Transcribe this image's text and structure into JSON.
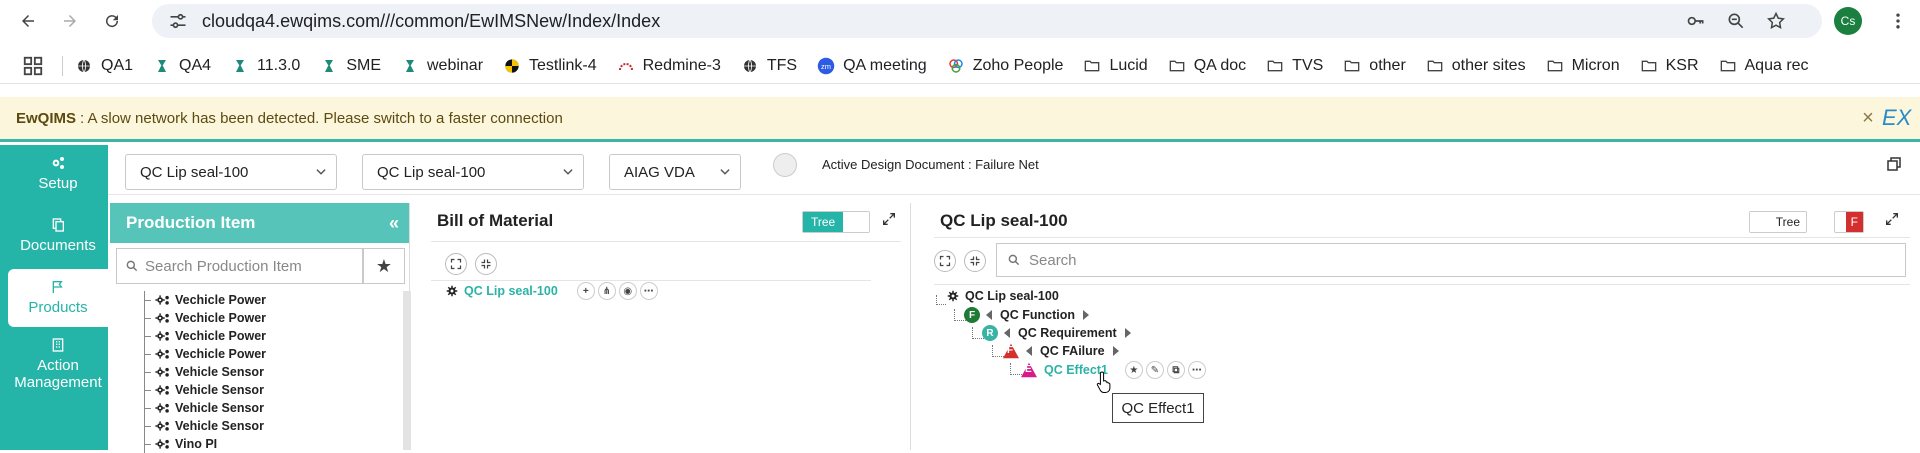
{
  "browser": {
    "url": "cloudqa4.ewqims.com///common/EwIMSNew/Index/Index",
    "avatar": "Cs"
  },
  "bookmarks": [
    {
      "label": "QA1",
      "icon": "globe-icon"
    },
    {
      "label": "QA4",
      "icon": "logo-icon"
    },
    {
      "label": "11.3.0",
      "icon": "logo-icon"
    },
    {
      "label": "SME",
      "icon": "logo-icon"
    },
    {
      "label": "webinar",
      "icon": "logo-icon"
    },
    {
      "label": "Testlink-4",
      "icon": "testlink-icon"
    },
    {
      "label": "Redmine-3",
      "icon": "redmine-icon"
    },
    {
      "label": "TFS",
      "icon": "globe-icon"
    },
    {
      "label": "QA meeting",
      "icon": "zoom-icon"
    },
    {
      "label": "Zoho People",
      "icon": "zoho-icon"
    },
    {
      "label": "Lucid",
      "icon": "folder-icon"
    },
    {
      "label": "QA doc",
      "icon": "folder-icon"
    },
    {
      "label": "TVS",
      "icon": "folder-icon"
    },
    {
      "label": "other",
      "icon": "folder-icon"
    },
    {
      "label": "other sites",
      "icon": "folder-icon"
    },
    {
      "label": "Micron",
      "icon": "folder-icon"
    },
    {
      "label": "KSR",
      "icon": "folder-icon"
    },
    {
      "label": "Aqua rec",
      "icon": "folder-icon"
    }
  ],
  "warning": {
    "brand": "EwQIMS",
    "message": ": A slow network has been detected. Please switch to a faster connection",
    "close": "×",
    "ex": "EX"
  },
  "nav": {
    "setup": "Setup",
    "documents": "Documents",
    "products": "Products",
    "action_line1": "Action",
    "action_line2": "Management"
  },
  "toolbar": {
    "select1": "QC Lip seal-100",
    "select2": "QC Lip seal-100",
    "select3": "AIAG VDA",
    "active_doc": "Active Design Document : Failure Net"
  },
  "production": {
    "title": "Production Item",
    "collapse": "«",
    "search_placeholder": "Search Production Item",
    "items": [
      "Vechicle Power",
      "Vechicle Power",
      "Vechicle Power",
      "Vechicle Power",
      "Vehicle Sensor",
      "Vehicle Sensor",
      "Vehicle Sensor",
      "Vehicle Sensor",
      "Vino PI"
    ]
  },
  "bom": {
    "title": "Bill of Material",
    "toggle_label": "Tree",
    "root": "QC Lip seal-100",
    "actions": [
      "+",
      "⋔",
      "◉",
      "⋯"
    ]
  },
  "qc": {
    "title": "QC Lip seal-100",
    "toggle_label": "Tree",
    "toggle_f": "F",
    "search_placeholder": "Search",
    "root": "QC Lip seal-100",
    "function": {
      "badge": "F",
      "label": "QC Function"
    },
    "requirement": {
      "badge": "R",
      "label": "QC Requirement"
    },
    "failure": {
      "badge": "F",
      "label": "QC FAilure"
    },
    "effect": {
      "badge": "E",
      "label": "QC Effect1"
    },
    "effect_actions": [
      "★",
      "✎",
      "⧉",
      "⋯"
    ],
    "tooltip": "QC Effect1",
    "colors": {
      "function": "#1e7a35",
      "requirement": "#39b3a6",
      "failure": "#d32f2f",
      "effect": "#d81b8a"
    }
  }
}
